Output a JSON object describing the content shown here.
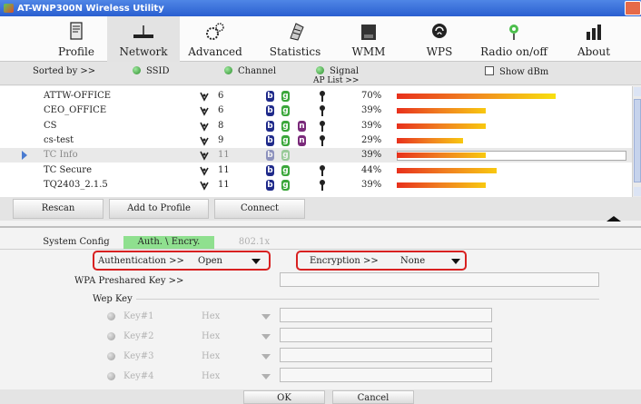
{
  "window": {
    "title": "AT-WNP300N Wireless Utility"
  },
  "toolbar": {
    "items": [
      {
        "label": "Profile",
        "icon": "profile-icon"
      },
      {
        "label": "Network",
        "icon": "network-icon",
        "active": true
      },
      {
        "label": "Advanced",
        "icon": "advanced-icon"
      },
      {
        "label": "Statistics",
        "icon": "statistics-icon"
      },
      {
        "label": "WMM",
        "icon": "wmm-icon"
      },
      {
        "label": "WPS",
        "icon": "wps-icon"
      },
      {
        "label": "Radio on/off",
        "icon": "radio-icon"
      },
      {
        "label": "About",
        "icon": "about-icon"
      }
    ]
  },
  "sortbar": {
    "sorted_by": "Sorted by >>",
    "ssid": "SSID",
    "channel": "Channel",
    "signal": "Signal",
    "show_dbm": "Show dBm",
    "ap_list": "AP List >>"
  },
  "networks": [
    {
      "ssid": "ATTW-OFFICE",
      "channel": "6",
      "b": true,
      "g": true,
      "n": false,
      "secure": true,
      "signal": "70%",
      "level": 0.7
    },
    {
      "ssid": "CEO_OFFICE",
      "channel": "6",
      "b": true,
      "g": true,
      "n": false,
      "secure": true,
      "signal": "39%",
      "level": 0.39
    },
    {
      "ssid": "CS",
      "channel": "8",
      "b": true,
      "g": true,
      "n": true,
      "secure": true,
      "signal": "39%",
      "level": 0.39
    },
    {
      "ssid": "cs-test",
      "channel": "9",
      "b": true,
      "g": true,
      "n": true,
      "secure": true,
      "signal": "29%",
      "level": 0.29
    },
    {
      "ssid": "TC Info",
      "channel": "11",
      "b": true,
      "g": true,
      "n": false,
      "secure": false,
      "signal": "39%",
      "level": 0.39,
      "selected": true
    },
    {
      "ssid": "TC Secure",
      "channel": "11",
      "b": true,
      "g": true,
      "n": false,
      "secure": true,
      "signal": "44%",
      "level": 0.44
    },
    {
      "ssid": "TQ2403_2.1.5",
      "channel": "11",
      "b": true,
      "g": true,
      "n": false,
      "secure": true,
      "signal": "39%",
      "level": 0.39
    }
  ],
  "actions": {
    "rescan": "Rescan",
    "add_to_profile": "Add to Profile",
    "connect": "Connect"
  },
  "tabs": {
    "system_config": "System Config",
    "auth_encry": "Auth. \\ Encry.",
    "dot1x": "802.1x"
  },
  "auth": {
    "authentication_label": "Authentication >>",
    "authentication_value": "Open",
    "encryption_label": "Encryption >>",
    "encryption_value": "None",
    "wpa_preshared_label": "WPA Preshared Key >>",
    "wep_key_label": "Wep Key",
    "keys": [
      {
        "label": "Key#1",
        "format": "Hex"
      },
      {
        "label": "Key#2",
        "format": "Hex"
      },
      {
        "label": "Key#3",
        "format": "Hex"
      },
      {
        "label": "Key#4",
        "format": "Hex"
      }
    ]
  },
  "dialog": {
    "ok": "OK",
    "cancel": "Cancel"
  },
  "colors": {
    "highlight_red": "#d82020",
    "active_tab": "#8fe08f",
    "title_blue": "#2a5fd0"
  }
}
